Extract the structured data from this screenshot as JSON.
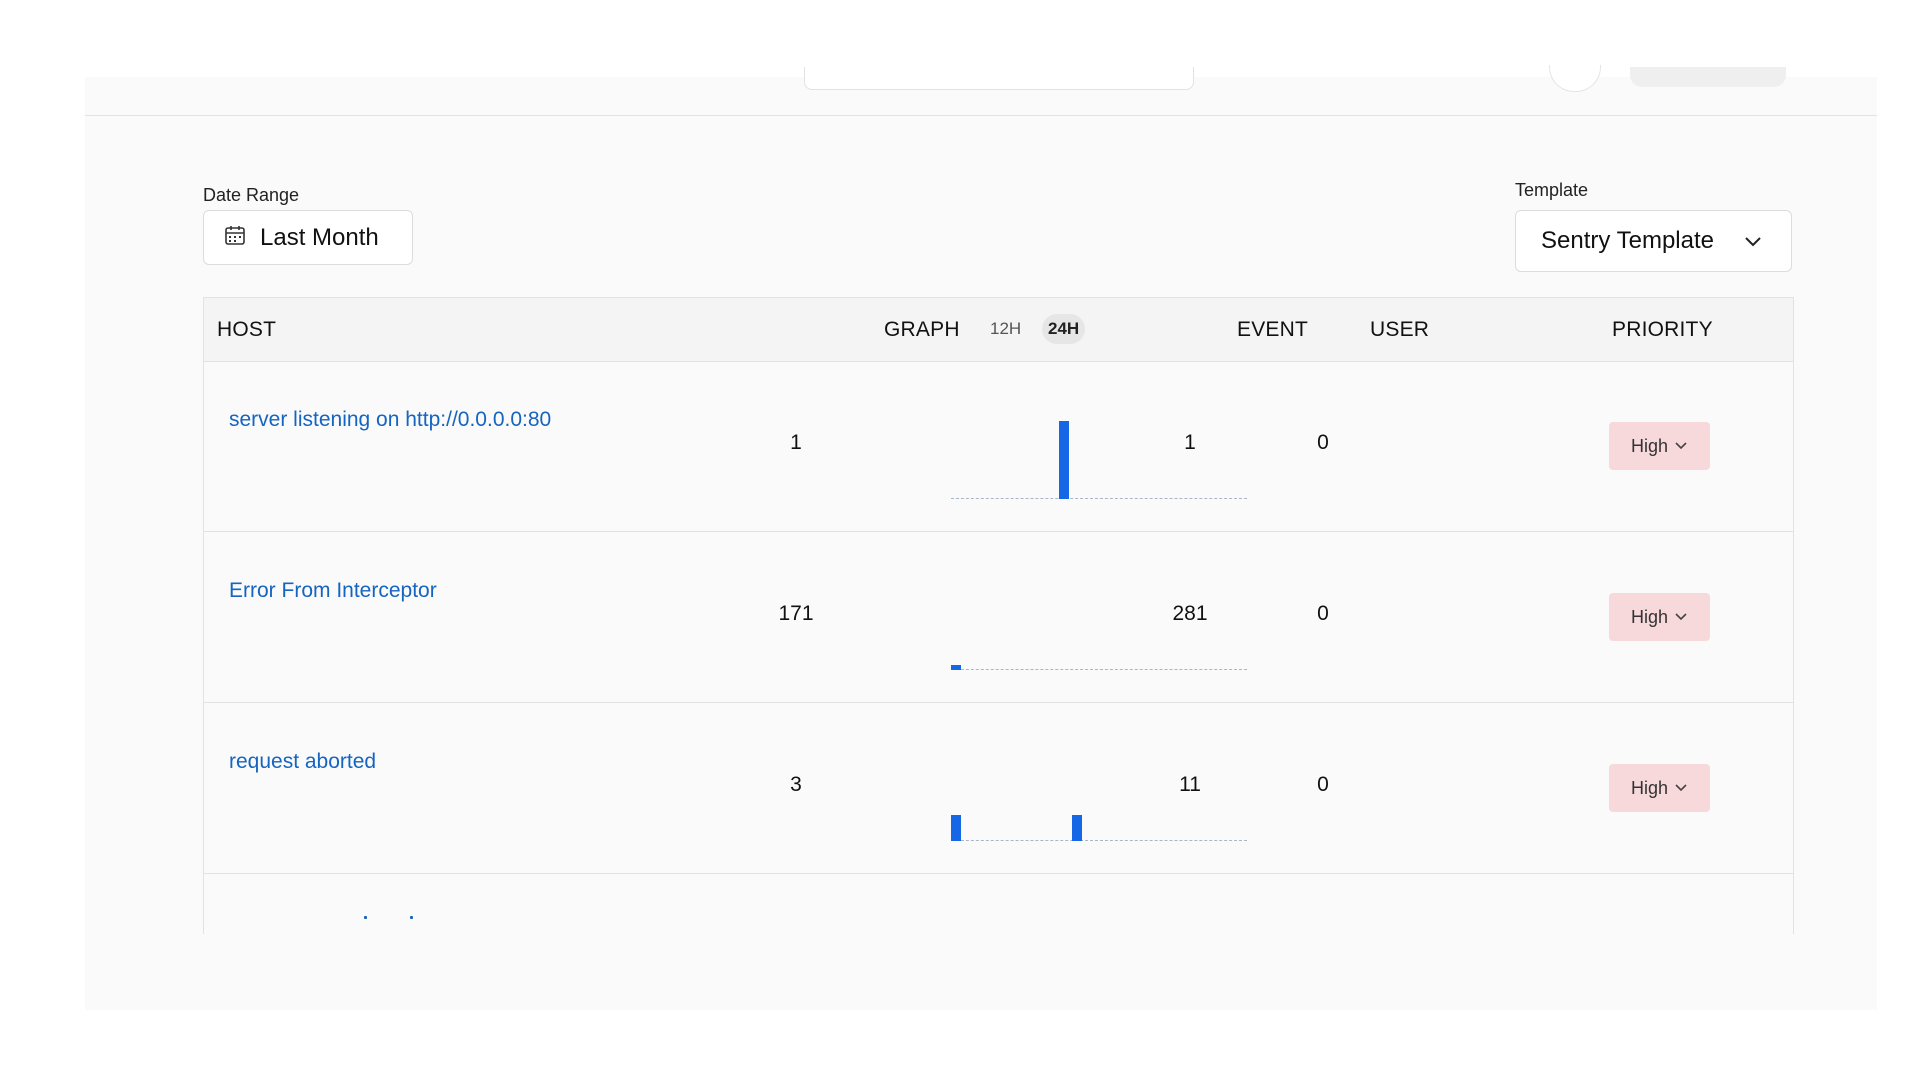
{
  "filters": {
    "date_range_label": "Date Range",
    "date_range_value": "Last Month",
    "template_label": "Template",
    "template_value": "Sentry Template"
  },
  "table": {
    "headers": {
      "host": "HOST",
      "graph": "GRAPH",
      "toggle_12h": "12H",
      "toggle_24h": "24H",
      "event": "EVENT",
      "user": "USER",
      "priority": "PRIORITY"
    },
    "active_toggle": "24H",
    "rows": [
      {
        "host": "server listening on http://0.0.0.0:80",
        "graph_count": "1",
        "event": "1",
        "user": "0",
        "priority": "High",
        "bars": [
          {
            "slot": 8,
            "level": 1.0
          }
        ]
      },
      {
        "host": "Error From Interceptor",
        "graph_count": "171",
        "event": "281",
        "user": "0",
        "priority": "High",
        "bars": [
          {
            "slot": 0,
            "level": 0.06
          }
        ]
      },
      {
        "host": "request aborted",
        "graph_count": "3",
        "event": "11",
        "user": "0",
        "priority": "High",
        "bars": [
          {
            "slot": 0,
            "level": 0.33
          },
          {
            "slot": 9,
            "level": 0.33
          }
        ]
      }
    ]
  },
  "colors": {
    "link": "#1565c0",
    "bar": "#1667e6",
    "priority_bg": "#f7d9dc"
  },
  "icons": {
    "date": "calendar-icon",
    "template": "chevron-down-icon",
    "priority": "chevron-down-icon"
  }
}
